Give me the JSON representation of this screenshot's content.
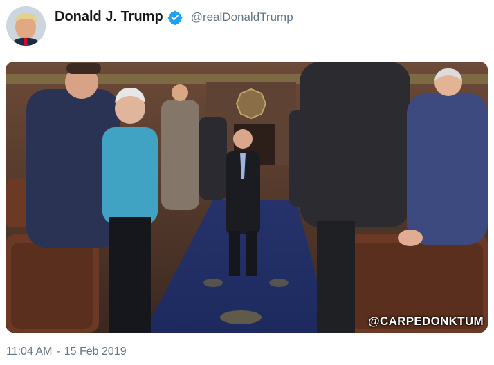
{
  "tweet": {
    "display_name": "Donald J. Trump",
    "handle": "@realDonaldTrump",
    "time": "11:04 AM",
    "separator": "-",
    "date": "15 Feb 2019"
  },
  "media": {
    "watermark": "@CARPEDONKTUM"
  },
  "colors": {
    "verified": "#1da1f2",
    "name": "#14171a",
    "secondary_text": "#657786"
  }
}
